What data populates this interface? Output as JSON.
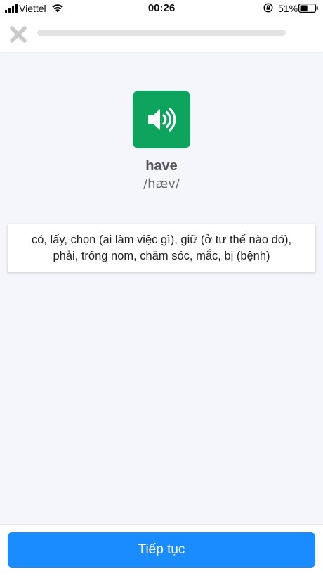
{
  "status_bar": {
    "carrier": "Viettel",
    "time": "00:26",
    "battery_percent": "51%",
    "battery_level": 0.51,
    "icons": [
      "signal-icon",
      "wifi-icon",
      "rotation-lock-icon",
      "battery-icon"
    ]
  },
  "top_bar": {
    "close_icon": "close-icon",
    "progress": 0
  },
  "flashcard": {
    "audio_icon": "speaker-icon",
    "word": "have",
    "phonetic": "/hæv/",
    "meaning": "có, lấy, chọn (ai làm việc gì), giữ (ở tư thế nào đó), phải, trông nom, chăm sóc, mắc, bị (bệnh)"
  },
  "footer": {
    "continue_label": "Tiếp tục"
  },
  "colors": {
    "audio_button": "#0fa45e",
    "primary_button": "#1a8cff",
    "background": "#f4f6fb",
    "close_icon": "#c9c9c9",
    "progress_track": "#e3e3e3"
  }
}
